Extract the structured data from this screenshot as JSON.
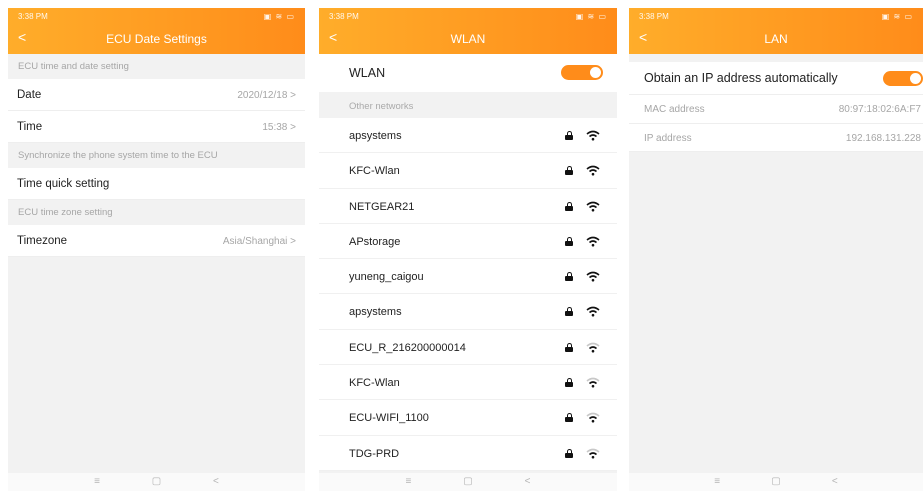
{
  "status_bar": {
    "time": "3:38 PM",
    "icons": "▣ ≋ ▭"
  },
  "screen1": {
    "title": "ECU Date Settings",
    "section1": "ECU time and date setting",
    "date_label": "Date",
    "date_value": "2020/12/18 >",
    "time_label": "Time",
    "time_value": "15:38 >",
    "section2": "Synchronize the phone system time to the ECU",
    "quick_label": "Time quick setting",
    "section3": "ECU time zone setting",
    "timezone_label": "Timezone",
    "timezone_value": "Asia/Shanghai >"
  },
  "screen2": {
    "title": "WLAN",
    "wlan_label": "WLAN",
    "wlan_enabled": true,
    "other_networks_label": "Other networks",
    "networks": [
      {
        "name": "apsystems",
        "locked": true,
        "signal": "strong"
      },
      {
        "name": "KFC-Wlan",
        "locked": true,
        "signal": "strong"
      },
      {
        "name": "NETGEAR21",
        "locked": true,
        "signal": "strong"
      },
      {
        "name": "APstorage",
        "locked": true,
        "signal": "strong"
      },
      {
        "name": "yuneng_caigou",
        "locked": true,
        "signal": "strong"
      },
      {
        "name": "apsystems",
        "locked": true,
        "signal": "strong"
      },
      {
        "name": "ECU_R_216200000014",
        "locked": true,
        "signal": "weak"
      },
      {
        "name": "KFC-Wlan",
        "locked": true,
        "signal": "weak"
      },
      {
        "name": "ECU-WIFI_1100",
        "locked": true,
        "signal": "weak"
      },
      {
        "name": "TDG-PRD",
        "locked": true,
        "signal": "weak"
      }
    ]
  },
  "screen3": {
    "title": "LAN",
    "auto_ip_label": "Obtain an IP address automatically",
    "auto_ip_enabled": true,
    "mac_label": "MAC address",
    "mac_value": "80:97:18:02:6A:F7",
    "ip_label": "IP address",
    "ip_value": "192.168.131.228"
  },
  "nav": {
    "menu": "≡",
    "home": "▢",
    "back": "<"
  },
  "back_glyph": "<",
  "colors": {
    "accent": "#ff8c1a",
    "accent_light": "#ffad2a"
  }
}
